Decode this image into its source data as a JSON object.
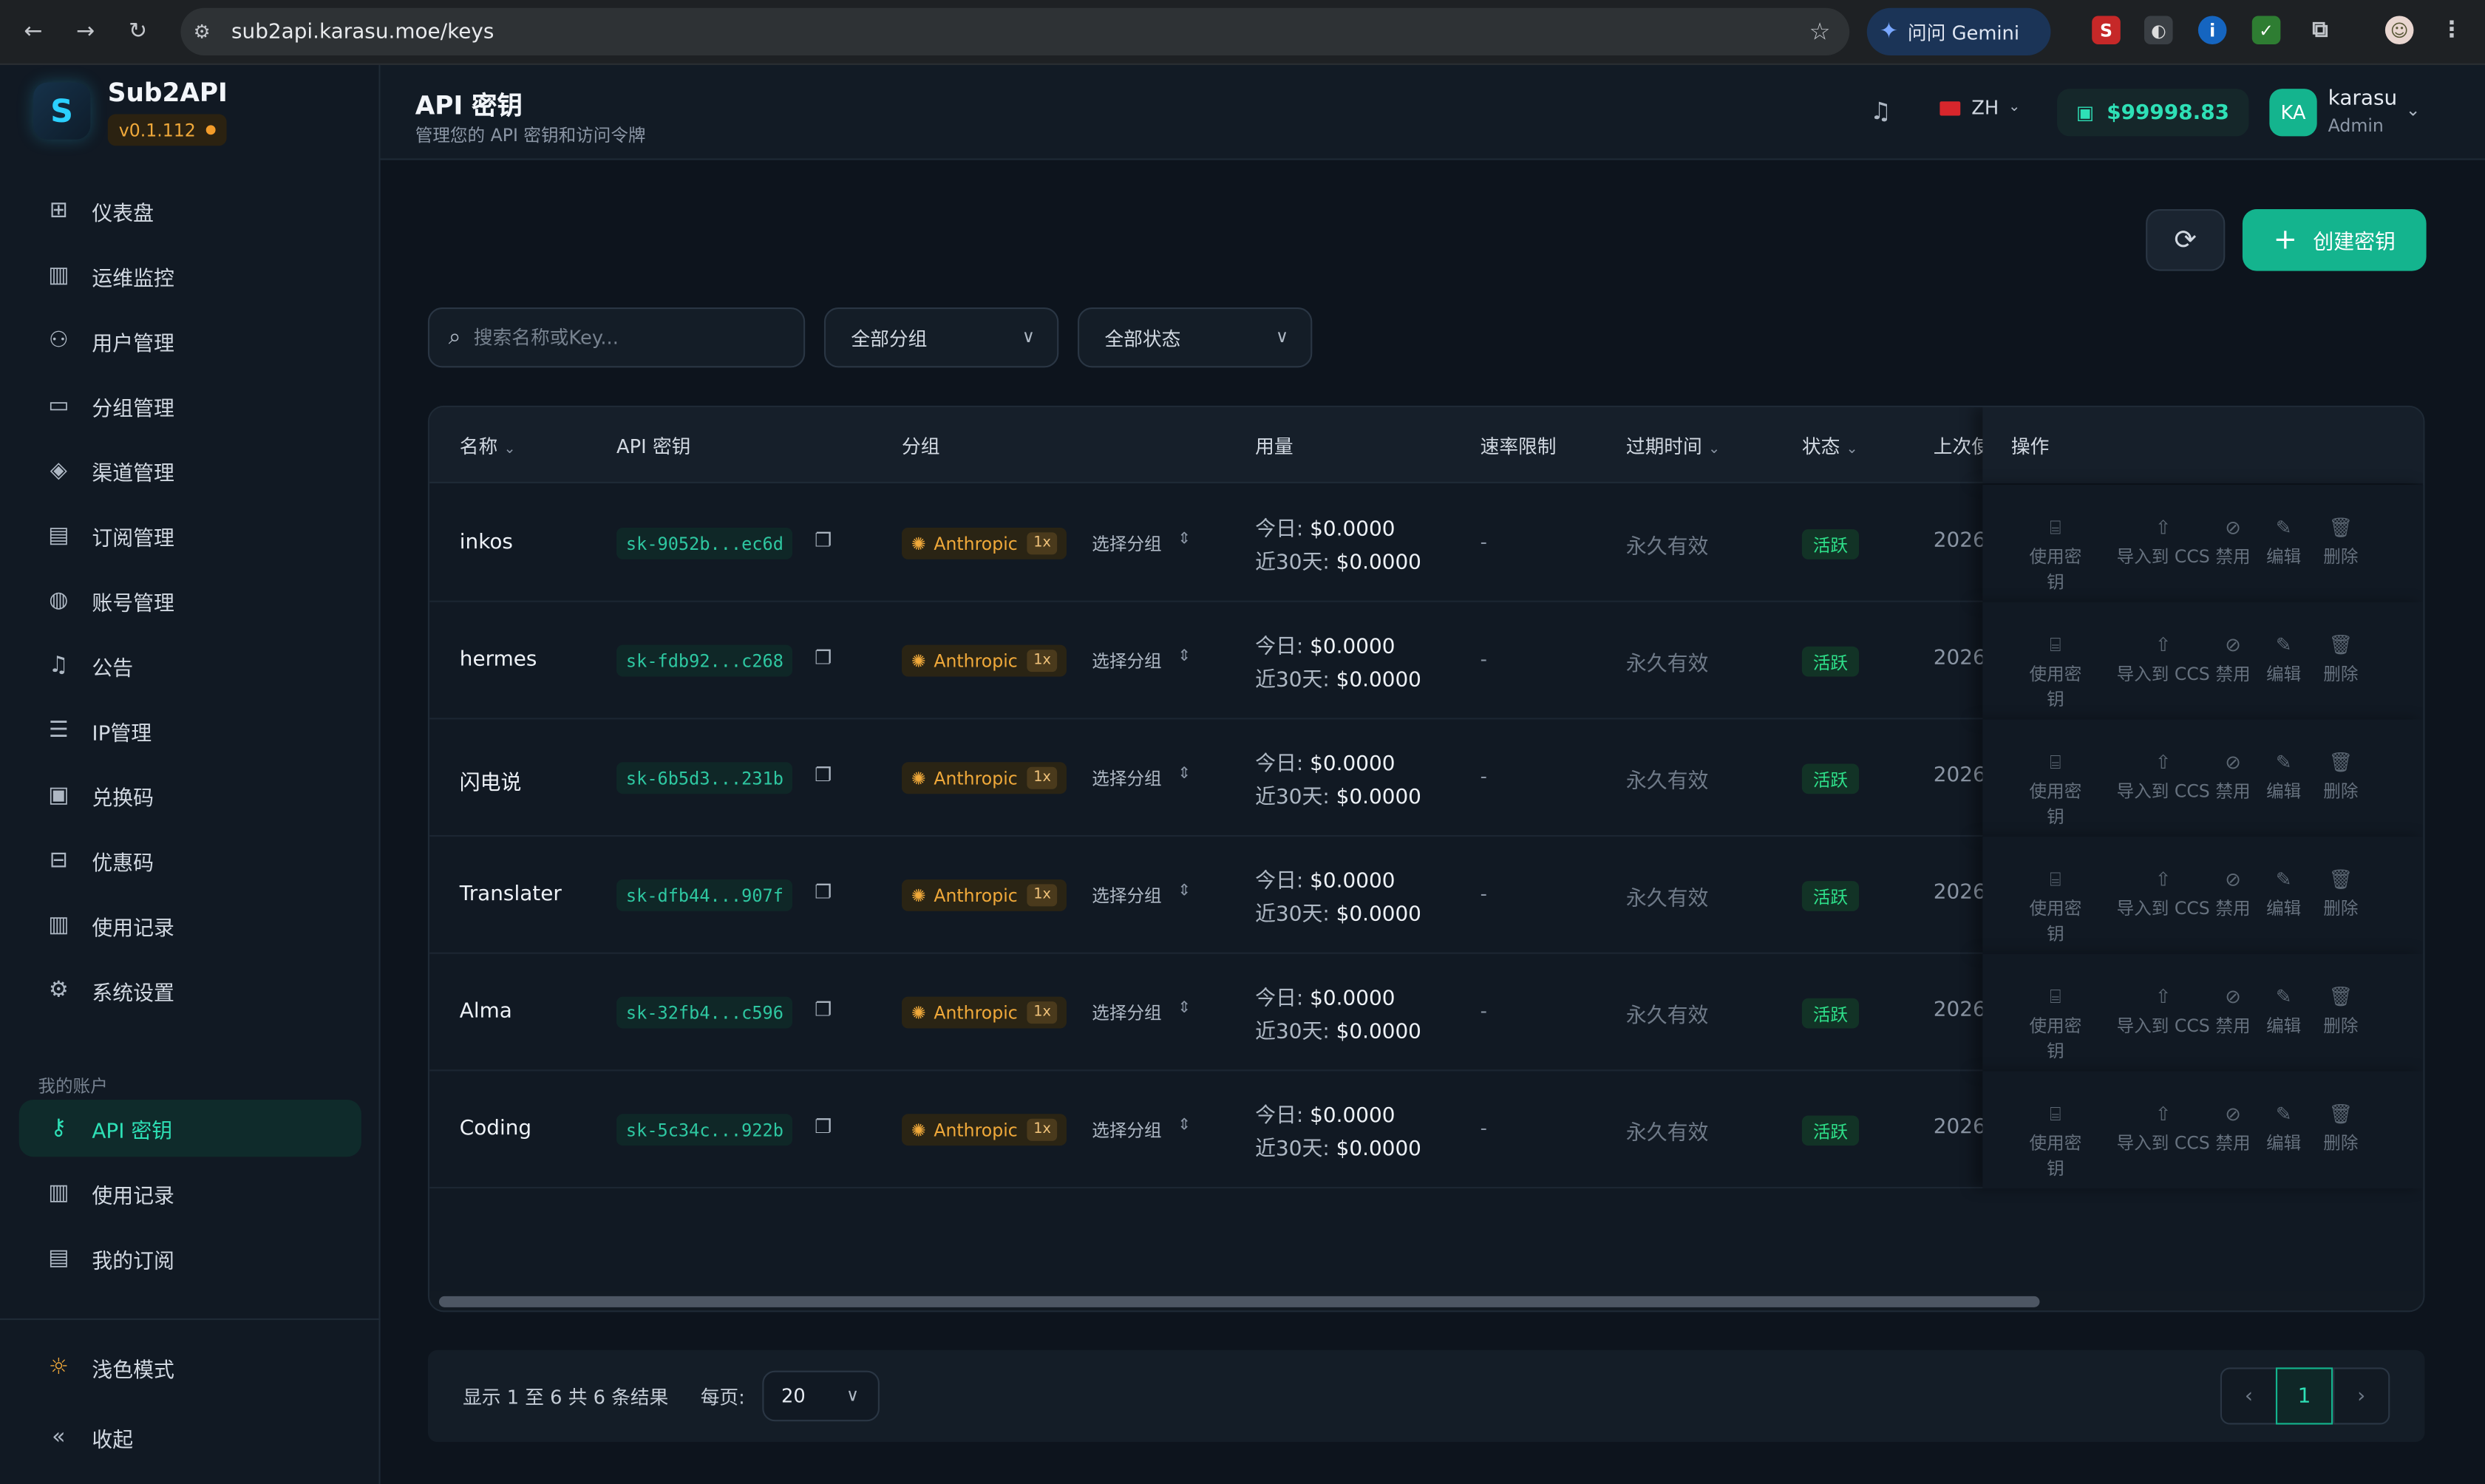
{
  "browser": {
    "url": "sub2api.karasu.moe/keys",
    "gemini_label": "问问 Gemini"
  },
  "app": {
    "name": "Sub2API",
    "version": "v0.1.112"
  },
  "sidebar": {
    "items": [
      {
        "label": "仪表盘",
        "icon": "grid-icon"
      },
      {
        "label": "运维监控",
        "icon": "bar-chart-icon"
      },
      {
        "label": "用户管理",
        "icon": "users-icon"
      },
      {
        "label": "分组管理",
        "icon": "folder-icon"
      },
      {
        "label": "渠道管理",
        "icon": "layers-icon"
      },
      {
        "label": "订阅管理",
        "icon": "card-icon"
      },
      {
        "label": "账号管理",
        "icon": "globe-icon"
      },
      {
        "label": "公告",
        "icon": "bell-icon"
      },
      {
        "label": "IP管理",
        "icon": "database-icon"
      },
      {
        "label": "兑换码",
        "icon": "ticket-icon"
      },
      {
        "label": "优惠码",
        "icon": "gift-icon"
      },
      {
        "label": "使用记录",
        "icon": "bar-chart-icon"
      },
      {
        "label": "系统设置",
        "icon": "gear-icon"
      }
    ],
    "section_label": "我的账户",
    "account_items": [
      {
        "label": "API 密钥",
        "icon": "key-icon",
        "active": true
      },
      {
        "label": "使用记录",
        "icon": "bar-chart-icon"
      },
      {
        "label": "我的订阅",
        "icon": "card-icon"
      }
    ],
    "theme_toggle": "浅色模式",
    "collapse": "收起"
  },
  "header": {
    "title": "API 密钥",
    "subtitle": "管理您的 API 密钥和访问令牌",
    "lang": "ZH",
    "balance": "$99998.83",
    "avatar_initials": "KA",
    "username": "karasu",
    "role": "Admin"
  },
  "toolbar": {
    "create_label": "创建密钥",
    "search_placeholder": "搜索名称或Key...",
    "group_filter": "全部分组",
    "status_filter": "全部状态"
  },
  "table": {
    "columns": [
      "名称",
      "API 密钥",
      "分组",
      "用量",
      "速率限制",
      "过期时间",
      "状态",
      "上次使",
      "操作"
    ],
    "rows": [
      {
        "name": "inkos",
        "key": "sk-9052b...ec6d",
        "group": "Anthropic",
        "multiplier": "1x",
        "today": "$0.0000",
        "month": "$0.0000",
        "rate": "-",
        "expiry": "永久有效",
        "status": "活跃",
        "last_used": "2026"
      },
      {
        "name": "hermes",
        "key": "sk-fdb92...c268",
        "group": "Anthropic",
        "multiplier": "1x",
        "today": "$0.0000",
        "month": "$0.0000",
        "rate": "-",
        "expiry": "永久有效",
        "status": "活跃",
        "last_used": "2026"
      },
      {
        "name": "闪电说",
        "key": "sk-6b5d3...231b",
        "group": "Anthropic",
        "multiplier": "1x",
        "today": "$0.0000",
        "month": "$0.0000",
        "rate": "-",
        "expiry": "永久有效",
        "status": "活跃",
        "last_used": "2026"
      },
      {
        "name": "Translater",
        "key": "sk-dfb44...907f",
        "group": "Anthropic",
        "multiplier": "1x",
        "today": "$0.0000",
        "month": "$0.0000",
        "rate": "-",
        "expiry": "永久有效",
        "status": "活跃",
        "last_used": "2026"
      },
      {
        "name": "Alma",
        "key": "sk-32fb4...c596",
        "group": "Anthropic",
        "multiplier": "1x",
        "today": "$0.0000",
        "month": "$0.0000",
        "rate": "-",
        "expiry": "永久有效",
        "status": "活跃",
        "last_used": "2026"
      },
      {
        "name": "Coding",
        "key": "sk-5c34c...922b",
        "group": "Anthropic",
        "multiplier": "1x",
        "today": "$0.0000",
        "month": "$0.0000",
        "rate": "-",
        "expiry": "永久有效",
        "status": "活跃",
        "last_used": "2026"
      }
    ],
    "labels": {
      "select_group": "选择分组",
      "today": "今日:",
      "month": "近30天:"
    },
    "actions": [
      "使用密钥",
      "导入到 CCS",
      "禁用",
      "编辑",
      "删除"
    ]
  },
  "pagination": {
    "info": "显示 1 至 6 共 6 条结果",
    "per_page_label": "每页:",
    "per_page": "20",
    "current_page": "1"
  }
}
